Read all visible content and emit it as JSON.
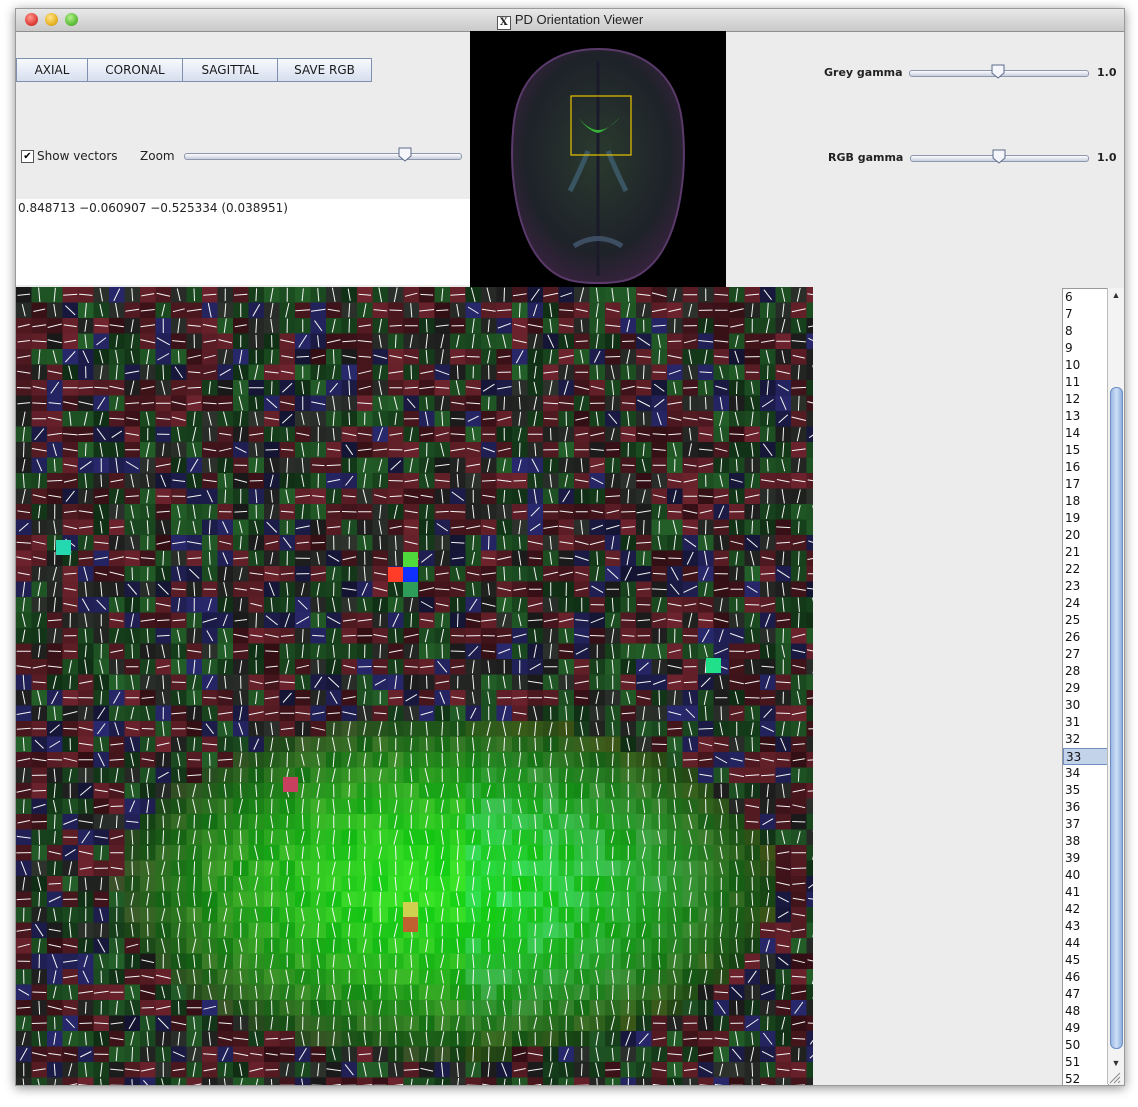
{
  "window": {
    "title": "PD Orientation Viewer"
  },
  "toolbar": {
    "axial": "AXIAL",
    "coronal": "CORONAL",
    "sagittal": "SAGITTAL",
    "save_rgb": "SAVE RGB"
  },
  "controls": {
    "show_vectors_label": "Show vectors",
    "show_vectors_checked": true,
    "zoom_label": "Zoom",
    "zoom_level": 0.8,
    "grey_gamma_label": "Grey gamma",
    "grey_gamma_value": "1.0",
    "grey_gamma_level": 0.5,
    "rgb_gamma_label": "RGB gamma",
    "rgb_gamma_value": "1.0",
    "rgb_gamma_level": 0.5
  },
  "readout": {
    "text": "0.848713 −0.060907 −0.525334 (0.038951)"
  },
  "slices": {
    "items": [
      "6",
      "7",
      "8",
      "9",
      "10",
      "11",
      "12",
      "13",
      "14",
      "15",
      "16",
      "17",
      "18",
      "19",
      "20",
      "21",
      "22",
      "23",
      "24",
      "25",
      "26",
      "27",
      "28",
      "29",
      "30",
      "31",
      "32",
      "33",
      "34",
      "35",
      "36",
      "37",
      "38",
      "39",
      "40",
      "41",
      "42",
      "43",
      "44",
      "45",
      "46",
      "47",
      "48",
      "49",
      "50",
      "51",
      "52"
    ],
    "selected": "33"
  },
  "icons": {
    "x11": "x11-icon",
    "check": "checkmark-icon"
  },
  "colors": {
    "button_border": "#7e8fb0",
    "roi_box": "#e8c400",
    "selection": "#c2d3ea"
  }
}
